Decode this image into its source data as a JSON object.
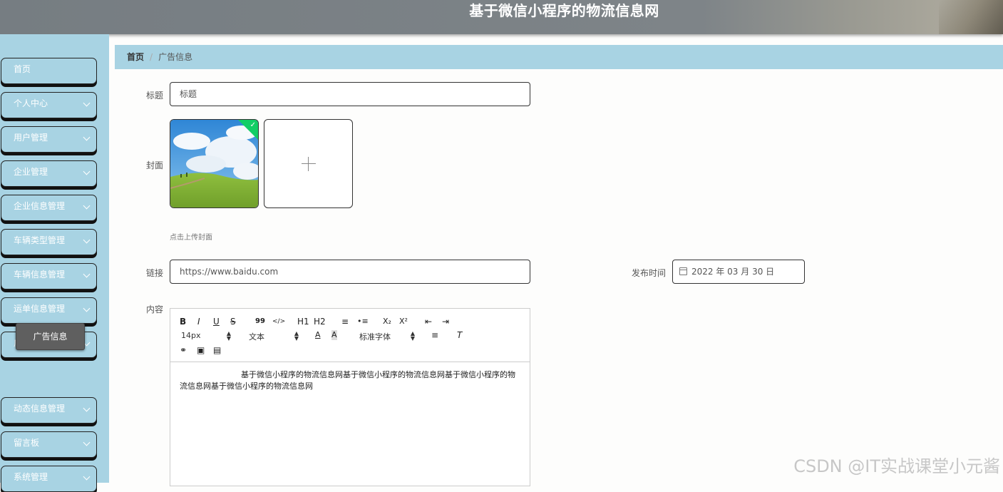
{
  "header": {
    "title": "基于微信小程序的物流信息网"
  },
  "sidebar": {
    "items": [
      {
        "label": "首页",
        "expandable": false
      },
      {
        "label": "个人中心",
        "expandable": true
      },
      {
        "label": "用户管理",
        "expandable": true
      },
      {
        "label": "企业管理",
        "expandable": true
      },
      {
        "label": "企业信息管理",
        "expandable": true
      },
      {
        "label": "车辆类型管理",
        "expandable": true
      },
      {
        "label": "车辆信息管理",
        "expandable": true
      },
      {
        "label": "运单信息管理",
        "expandable": true
      },
      {
        "label": "广告信息管理",
        "expandable": true
      },
      {
        "label": "动态信息管理",
        "expandable": true
      },
      {
        "label": "留言板",
        "expandable": true
      },
      {
        "label": "系统管理",
        "expandable": true
      }
    ],
    "sub_item": {
      "label": "广告信息"
    }
  },
  "breadcrumb": {
    "home": "首页",
    "current": "广告信息"
  },
  "form": {
    "title_label": "标题",
    "title_value": "标题",
    "cover_label": "封面",
    "cover_hint": "点击上传封面",
    "link_label": "链接",
    "link_value": "https://www.baidu.com",
    "publish_time_label": "发布时间",
    "publish_time_value": "2022 年 03 月 30 日",
    "content_label": "内容"
  },
  "editor": {
    "buttons_row1": [
      "B",
      "I",
      "U",
      "S",
      "99",
      "</>",
      "H1",
      "H2",
      "≡",
      "•≡",
      "X₂",
      "X²",
      "⇤",
      "⇥"
    ],
    "size_picker": "14px",
    "format_picker": "文本",
    "font_picker": "标准字体",
    "content_line1": "基于微信小程序的物流信息网基于微信小程序的物流信息网基于微信小程序的物",
    "content_line2": "流信息网基于微信小程序的物流信息网"
  },
  "watermark": "CSDN @IT实战课堂小元酱",
  "colors": {
    "sidebar_bg": "#a8d3e3",
    "header_bg": "#767d82",
    "active_sub": "#5f5f5f",
    "check": "#13ce66"
  }
}
